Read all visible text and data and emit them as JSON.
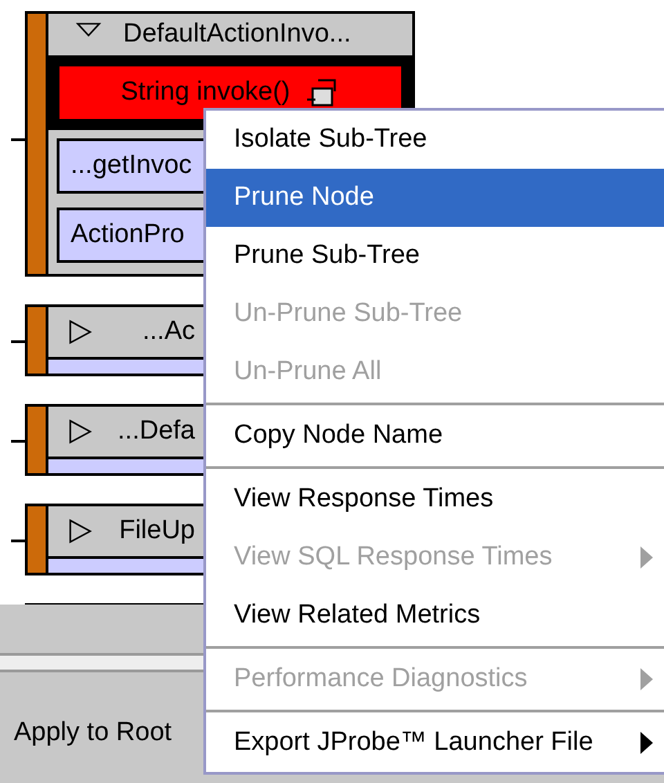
{
  "tree": {
    "nodes": [
      {
        "label": "DefaultActionInvo...",
        "expanded": true,
        "method": {
          "label": "String invoke()",
          "selected": true
        },
        "children": [
          {
            "label": "...getInvoc"
          },
          {
            "label": "ActionPro"
          }
        ]
      },
      {
        "label": "...Ac",
        "expanded": false
      },
      {
        "label": "...Defa",
        "expanded": false
      },
      {
        "label": "FileUp",
        "expanded": false
      }
    ]
  },
  "bottom_panel": {
    "label": "Apply to Root"
  },
  "context_menu": {
    "items": [
      {
        "kind": "item",
        "label": "Isolate Sub-Tree",
        "selected": false,
        "disabled": false,
        "submenu": false
      },
      {
        "kind": "item",
        "label": "Prune Node",
        "selected": true,
        "disabled": false,
        "submenu": false
      },
      {
        "kind": "item",
        "label": "Prune Sub-Tree",
        "selected": false,
        "disabled": false,
        "submenu": false
      },
      {
        "kind": "item",
        "label": "Un-Prune Sub-Tree",
        "selected": false,
        "disabled": true,
        "submenu": false
      },
      {
        "kind": "item",
        "label": "Un-Prune All",
        "selected": false,
        "disabled": true,
        "submenu": false
      },
      {
        "kind": "separator"
      },
      {
        "kind": "item",
        "label": "Copy Node Name",
        "selected": false,
        "disabled": false,
        "submenu": false
      },
      {
        "kind": "separator"
      },
      {
        "kind": "item",
        "label": "View Response Times",
        "selected": false,
        "disabled": false,
        "submenu": false
      },
      {
        "kind": "item",
        "label": "View SQL Response Times",
        "selected": false,
        "disabled": true,
        "submenu": true
      },
      {
        "kind": "item",
        "label": "View Related Metrics",
        "selected": false,
        "disabled": false,
        "submenu": false
      },
      {
        "kind": "separator"
      },
      {
        "kind": "item",
        "label": "Performance Diagnostics",
        "selected": false,
        "disabled": true,
        "submenu": true
      },
      {
        "kind": "separator"
      },
      {
        "kind": "item",
        "label": "Export JProbe™ Launcher File",
        "selected": false,
        "disabled": false,
        "submenu": true
      }
    ]
  }
}
